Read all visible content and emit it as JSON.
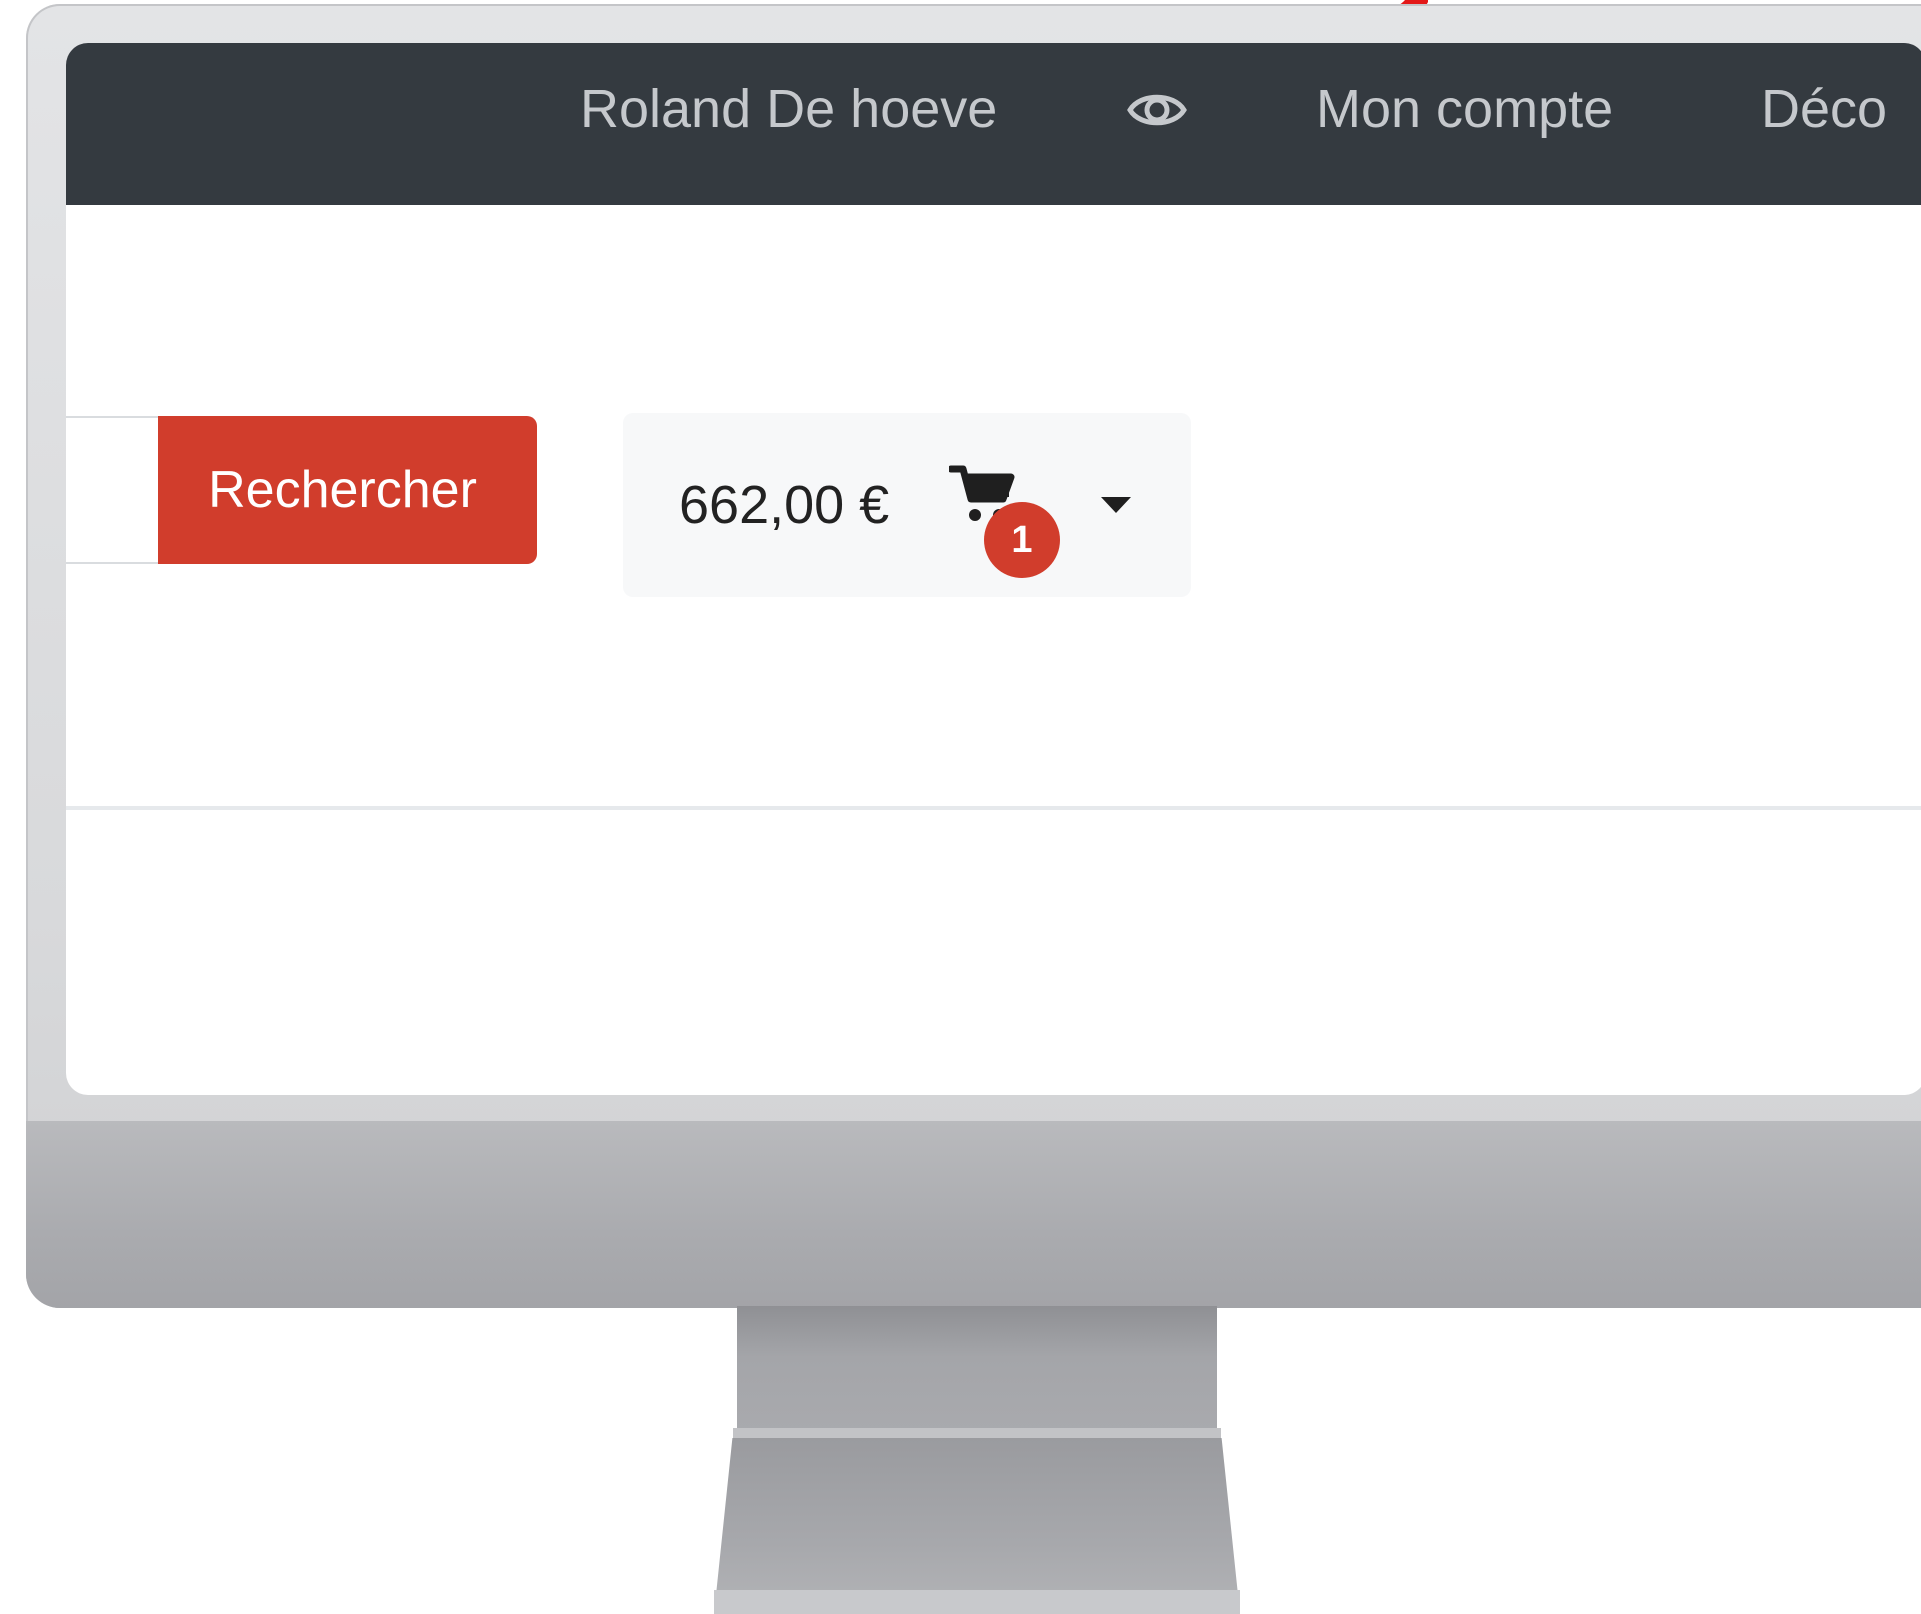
{
  "navbar": {
    "user_name": "Roland De hoeve",
    "account_label": "Mon compte",
    "logout_label": "Déco",
    "eye_icon": "eye-icon",
    "background": "#343a40"
  },
  "search": {
    "button_label": "Rechercher",
    "button_color": "#d13d2c",
    "placeholder": ""
  },
  "cart": {
    "total": "662,00 €",
    "item_count": "1",
    "cart_icon": "cart-icon",
    "dropdown_icon": "caret-down-icon"
  }
}
